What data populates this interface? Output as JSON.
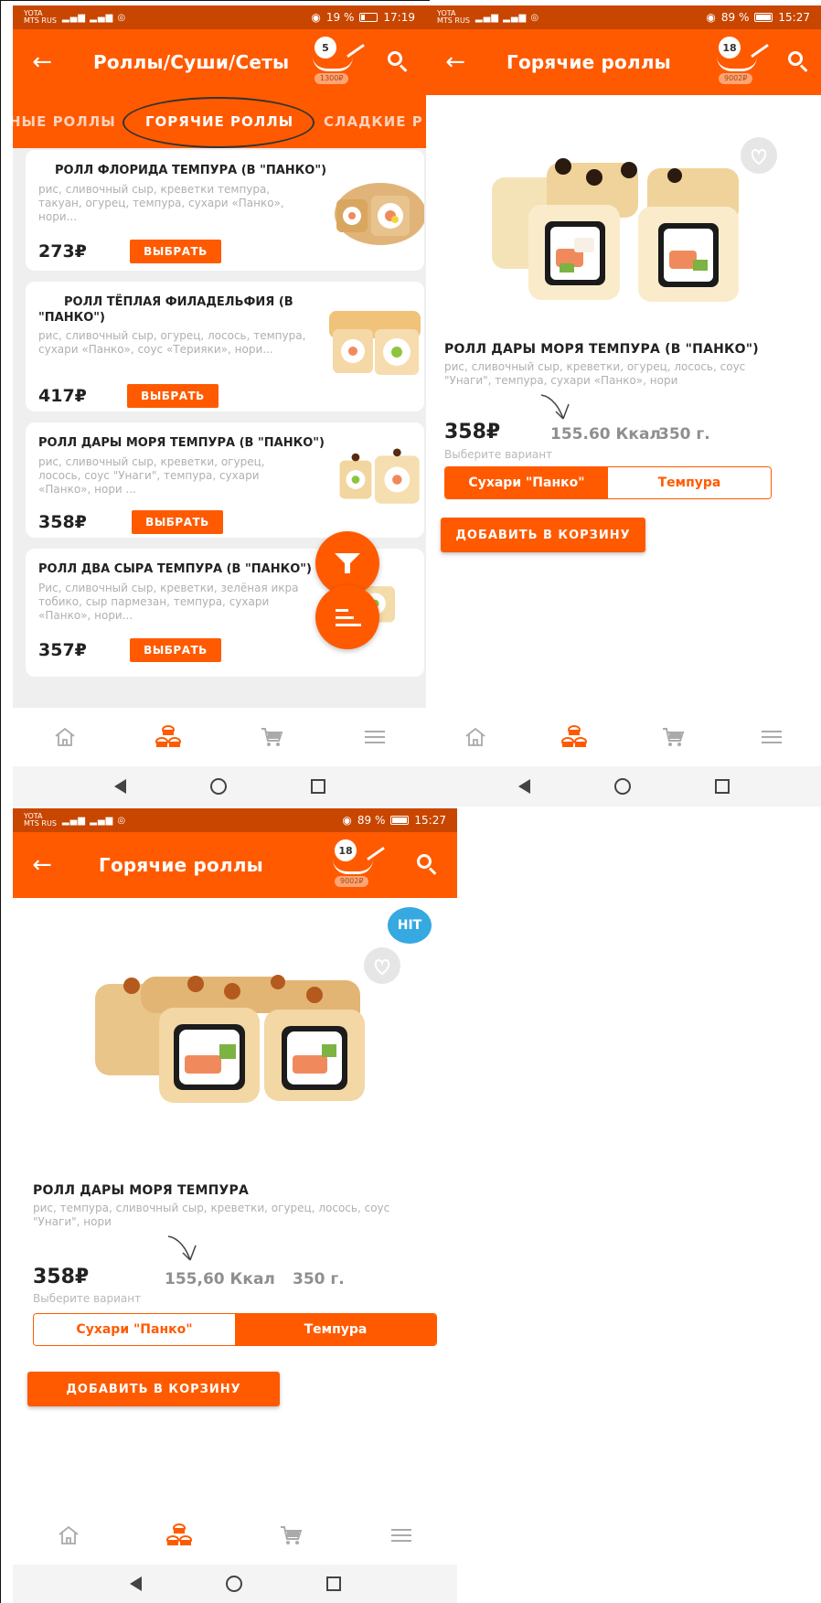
{
  "colors": {
    "accent": "#ff5a00",
    "status": "#c84600",
    "hit": "#36a9e1"
  },
  "icons": [
    "back-arrow-icon",
    "search-icon",
    "cart-bowl-icon",
    "home-icon",
    "sushi-icon",
    "shopping-cart-icon",
    "menu-icon",
    "heart-icon",
    "filter-icon",
    "sort-icon",
    "nav-back-icon",
    "nav-home-icon",
    "nav-recents-icon",
    "arrow-annotation-icon"
  ],
  "screen1": {
    "status": {
      "op1": "YOTA",
      "op2": "MTS RUS",
      "battery": "19 %",
      "time": "17:19"
    },
    "title": "Роллы/Суши/Сеты",
    "cart": {
      "count": "5",
      "sum": "1300₽"
    },
    "tabs": [
      "НЫЕ РОЛЛЫ",
      "ГОРЯЧИЕ РОЛЛЫ",
      "СЛАДКИЕ Р"
    ],
    "items": [
      {
        "name": "РОЛЛ ФЛОРИДА ТЕМПУРА (В \"ПАНКО\")",
        "desc": "рис, сливочный сыр, креветки темпура, такуан, огурец, темпура, сухари «Панко», нори...",
        "price": "273₽",
        "button": "ВЫБРАТЬ"
      },
      {
        "name": "РОЛЛ ТЁПЛАЯ ФИЛАДЕЛЬФИЯ (В \"ПАНКО\")",
        "desc": "рис, сливочный сыр, огурец, лосось, темпура, сухари «Панко», соус «Терияки», нори...",
        "price": "417₽",
        "button": "ВЫБРАТЬ"
      },
      {
        "name": "РОЛЛ ДАРЫ МОРЯ ТЕМПУРА (В \"ПАНКО\")",
        "desc": "рис, сливочный сыр, креветки, огурец, лосось, соус \"Унаги\", темпура, сухари «Панко», нори ...",
        "price": "358₽",
        "button": "ВЫБРАТЬ"
      },
      {
        "name": "РОЛЛ ДВА СЫРА ТЕМПУРА (В \"ПАНКО\")",
        "desc": "Рис, сливочный сыр, креветки, зелёная икра тобико, сыр пармезан, темпура, сухари «Панко», нори...",
        "price": "357₽",
        "button": "ВЫБРАТЬ"
      }
    ]
  },
  "screen2": {
    "status": {
      "op1": "YOTA",
      "op2": "MTS RUS",
      "battery": "89 %",
      "time": "15:27"
    },
    "title": "Горячие роллы",
    "cart": {
      "count": "18",
      "sum": "9002₽"
    },
    "name": "РОЛЛ ДАРЫ МОРЯ ТЕМПУРА (В \"ПАНКО\")",
    "desc": "рис, сливочный сыр, креветки, огурец, лосось, соус \"Унаги\", темпура, сухари «Панко», нори",
    "price": "358₽",
    "kcal": "155.60 Ккал",
    "weight": "350 г.",
    "choose": "Выберите вариант",
    "variants": [
      "Сухари \"Панко\"",
      "Темпура"
    ],
    "add": "ДОБАВИТЬ В КОРЗИНУ"
  },
  "screen3": {
    "status": {
      "op1": "YOTA",
      "op2": "MTS RUS",
      "battery": "89 %",
      "time": "15:27"
    },
    "title": "Горячие роллы",
    "cart": {
      "count": "18",
      "sum": "9002₽"
    },
    "hit": "HIT",
    "name": "РОЛЛ ДАРЫ МОРЯ ТЕМПУРА",
    "desc": "рис, темпура, сливочный сыр, креветки, огурец, лосось, соус \"Унаги\", нори",
    "price": "358₽",
    "kcal": "155,60 Ккал",
    "weight": "350 г.",
    "choose": "Выберите вариант",
    "variants": [
      "Сухари \"Панко\"",
      "Темпура"
    ],
    "add": "ДОБАВИТЬ В КОРЗИНУ"
  }
}
